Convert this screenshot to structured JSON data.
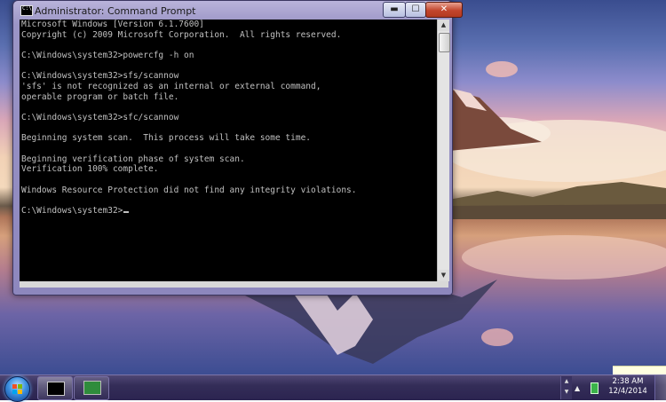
{
  "window": {
    "title": "Administrator: Command Prompt",
    "minimize_glyph": "▬",
    "maximize_glyph": "☐",
    "close_glyph": "✕",
    "icon": "cmd-icon"
  },
  "console": {
    "lines": [
      "Microsoft Windows [Version 6.1.7600]",
      "Copyright (c) 2009 Microsoft Corporation.  All rights reserved.",
      "",
      "C:\\Windows\\system32>powercfg -h on",
      "",
      "C:\\Windows\\system32>sfs/scannow",
      "'sfs' is not recognized as an internal or external command,",
      "operable program or batch file.",
      "",
      "C:\\Windows\\system32>sfc/scannow",
      "",
      "Beginning system scan.  This process will take some time.",
      "",
      "Beginning verification phase of system scan.",
      "Verification 100% complete.",
      "",
      "Windows Resource Protection did not find any integrity violations.",
      "",
      "C:\\Windows\\system32>"
    ]
  },
  "scrollbar": {
    "up_glyph": "▲",
    "down_glyph": "▼"
  },
  "taskbar": {
    "start_icon": "windows-logo-icon",
    "items": [
      {
        "name": "command-prompt",
        "icon": "cmd-icon"
      },
      {
        "name": "system",
        "icon": "system-icon"
      }
    ],
    "tray": {
      "scroll_up_glyph": "▲",
      "scroll_down_glyph": "▼",
      "show_hidden_glyph": "▲",
      "time": "2:38 AM",
      "date": "12/4/2014"
    }
  },
  "colors": {
    "console_bg": "#000000",
    "console_fg": "#c0c0c0",
    "taskbar": "#342d58"
  }
}
